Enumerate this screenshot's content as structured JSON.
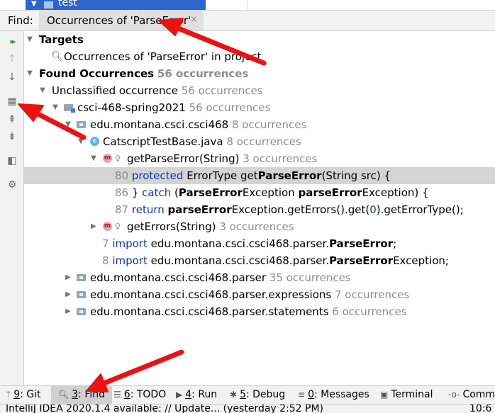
{
  "top": {
    "selected_item": "test"
  },
  "find": {
    "label": "Find:",
    "tab_title": "Occurrences of 'ParseError'",
    "close": "×"
  },
  "toolbar": {
    "rerun": "▸▸",
    "up": "↑",
    "down": "↓",
    "group": "▦",
    "expand": "⇞",
    "collapse": "⇟",
    "preview": "◧",
    "settings": "⚙"
  },
  "tree": {
    "targets": "Targets",
    "target_item": "Occurrences of 'ParseError' in project",
    "found": "Found Occurrences",
    "found_count": "56 occurrences",
    "unclassified": "Unclassified occurrence",
    "unclassified_count": "56 occurrences",
    "module": "csci-468-spring2021",
    "module_count": "56 occurrences",
    "pkg_main": "edu.montana.csci.csci468",
    "pkg_main_count": "8 occurrences",
    "class_file": "CatscriptTestBase.java",
    "class_file_count": "8 occurrences",
    "method1": "getParseError(String)",
    "method1_count": "3 occurrences",
    "line80": {
      "num": "80",
      "kw": "protected",
      "a": "ErrorType get",
      "b": "ParseError",
      "c": "(String src) {"
    },
    "line86": {
      "num": "86",
      "a": "} ",
      "kw": "catch",
      "c1": " (",
      "b1": "ParseError",
      "c2": "Exception ",
      "b2": "parseError",
      "c3": "Exception) {"
    },
    "line87": {
      "num": "87",
      "kw": "return",
      "sp": " ",
      "b": "parseError",
      "c": "Exception.getErrors().get(",
      "zero": "0",
      "d": ").getErrorType();"
    },
    "method2": "getErrors(String)",
    "method2_count": "3 occurrences",
    "line7": {
      "num": "7",
      "kw": "import",
      "a": " edu.montana.csci.csci468.parser.",
      "b": "ParseError",
      "c": ";"
    },
    "line8": {
      "num": "8",
      "kw": "import",
      "a": " edu.montana.csci.csci468.parser.",
      "b": "ParseError",
      "c": "Exception;"
    },
    "pkg_parser": "edu.montana.csci.csci468.parser",
    "pkg_parser_count": "35 occurrences",
    "pkg_expr": "edu.montana.csci.csci468.parser.expressions",
    "pkg_expr_count": "7 occurrences",
    "pkg_stmt": "edu.montana.csci.csci468.parser.statements",
    "pkg_stmt_count": "6 occurrences"
  },
  "bottom_tabs": [
    {
      "key": "9",
      "label": ": Git"
    },
    {
      "key": "3",
      "label": ": Find"
    },
    {
      "key": "6",
      "label": ": TODO"
    },
    {
      "key": "4",
      "label": ": Run"
    },
    {
      "key": "5",
      "label": ": Debug"
    },
    {
      "key": "0",
      "label": ": Messages"
    },
    {
      "key": "",
      "label": "Terminal"
    },
    {
      "key": "",
      "label": "Commit"
    }
  ],
  "status": {
    "message": "IntelliJ IDEA 2020.1.4 available: // Update... (yesterday 2:52 PM)",
    "position": "10:6"
  },
  "colors": {
    "annotation_arrow": "#ee1111",
    "selection": "#d4d4d4",
    "keyword": "#0f36b0"
  }
}
